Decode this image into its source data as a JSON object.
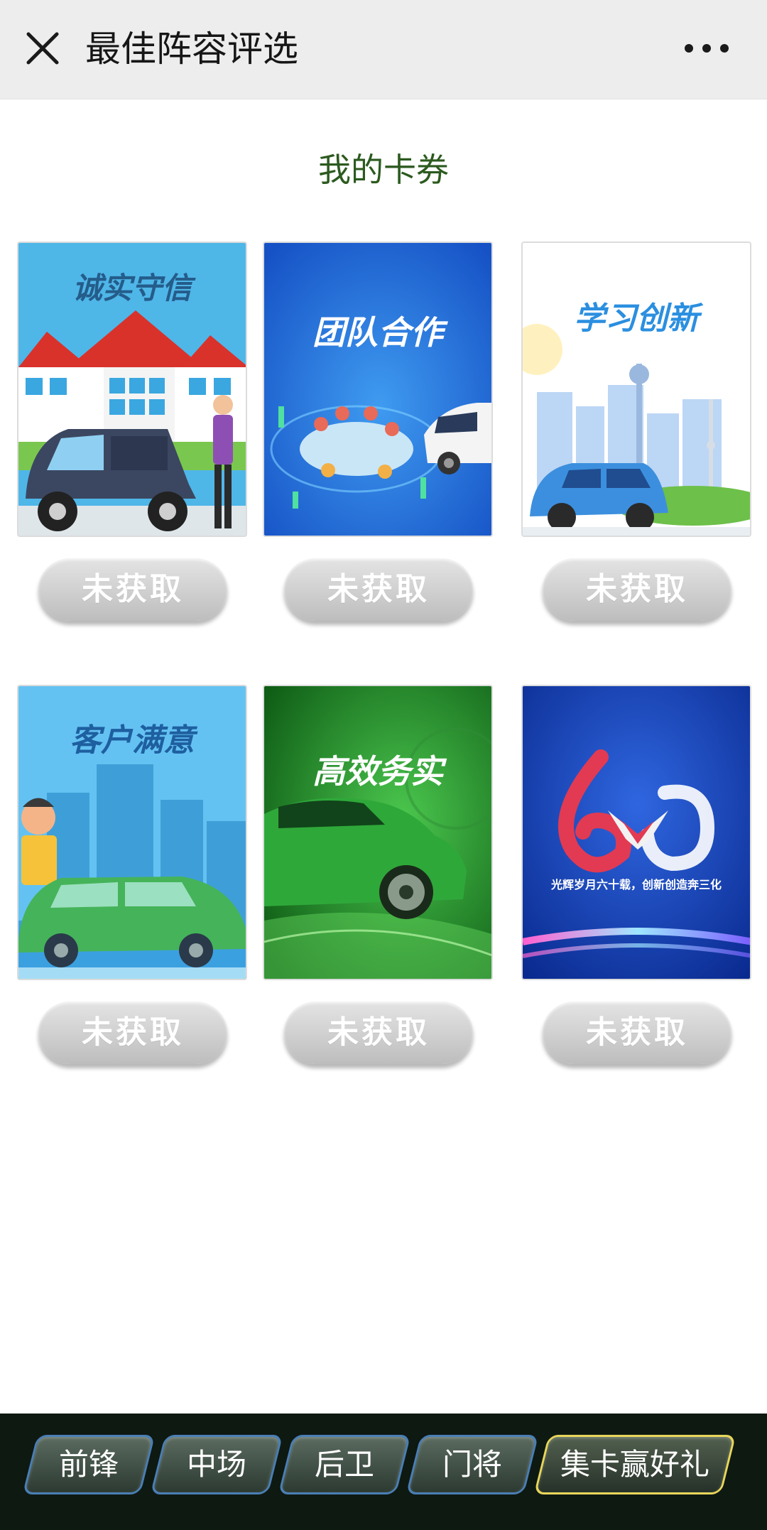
{
  "header": {
    "title": "最佳阵容评选",
    "close_icon": "close-icon",
    "more_icon": "more-dots-icon"
  },
  "section_title": "我的卡券",
  "cards": [
    {
      "caption": "诚实守信",
      "status": "未获取"
    },
    {
      "caption": "团队合作",
      "status": "未获取"
    },
    {
      "caption": "学习创新",
      "status": "未获取"
    },
    {
      "caption": "客户满意",
      "status": "未获取"
    },
    {
      "caption": "高效务实",
      "status": "未获取"
    },
    {
      "caption": "光辉岁月六十载，创新创造奔三化",
      "status": "未获取"
    }
  ],
  "bottom_nav": [
    {
      "label": "前锋"
    },
    {
      "label": "中场"
    },
    {
      "label": "后卫"
    },
    {
      "label": "门将"
    },
    {
      "label": "集卡赢好礼"
    }
  ],
  "colors": {
    "header_bg": "#ededed",
    "section_title": "#2c5a1f",
    "nav_bg": "#0e1912",
    "nav_border": "#4a7fb6",
    "nav_highlight_border": "#e8d65a",
    "status_button": "#cfcfcf"
  }
}
